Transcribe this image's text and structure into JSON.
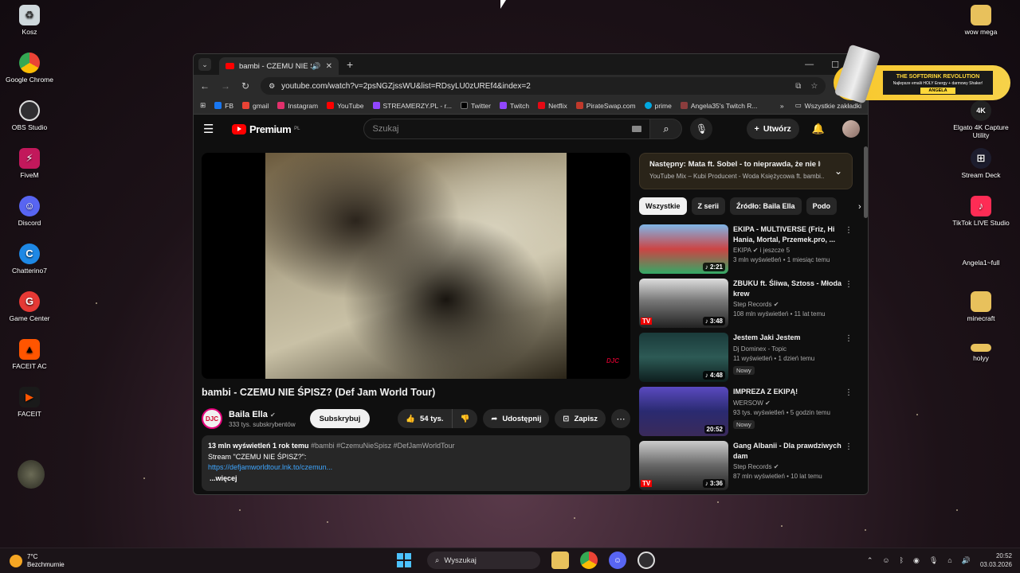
{
  "desktop": {
    "icons_left": [
      {
        "label": "Kosz",
        "icon": "recycle-bin-icon"
      },
      {
        "label": "Google Chrome",
        "icon": "chrome-icon"
      },
      {
        "label": "OBS Studio",
        "icon": "obs-icon"
      },
      {
        "label": "FiveM",
        "icon": "fivem-icon"
      },
      {
        "label": "Discord",
        "icon": "discord-icon"
      },
      {
        "label": "Chatterino7",
        "icon": "chatterino-icon"
      },
      {
        "label": "Game Center",
        "icon": "game-center-icon"
      },
      {
        "label": "FACEIT AC",
        "icon": "faceit-ac-icon"
      },
      {
        "label": "FACEIT",
        "icon": "faceit-icon"
      }
    ],
    "icons_right": [
      {
        "label": "wow mega",
        "icon": "folder-icon"
      },
      {
        "label": "Elgato 4K Capture Utility",
        "icon": "elgato-icon"
      },
      {
        "label": "Stream Deck",
        "icon": "stream-deck-icon"
      },
      {
        "label": "TikTok LIVE Studio",
        "icon": "tiktok-icon"
      },
      {
        "label": "Angela1~full",
        "icon": "file-icon"
      },
      {
        "label": "minecraft",
        "icon": "folder-icon"
      },
      {
        "label": "holyy",
        "icon": "folder-icon"
      }
    ],
    "overlay_ad": {
      "headline": "THE SOFTDRINK REVOLUTION",
      "sub": "Najlepsze emalii HOLY Energy + darmowy Shaker!",
      "name": "ANGELA"
    }
  },
  "browser": {
    "tab_title": "bambi - CZEMU NIE ŚPISZ",
    "url": "youtube.com/watch?v=2psNGZjssWU&list=RDsyLU0zUREf4&index=2",
    "bookmarks": [
      {
        "label": "FB",
        "color": "#1877f2"
      },
      {
        "label": "gmail",
        "color": "#ea4335"
      },
      {
        "label": "Instagram",
        "color": "#e1306c"
      },
      {
        "label": "YouTube",
        "color": "#ff0000"
      },
      {
        "label": "STREAMERZY.PL - r...",
        "color": "#9146ff"
      },
      {
        "label": "Twitter",
        "color": "#000000"
      },
      {
        "label": "Twitch",
        "color": "#9146ff"
      },
      {
        "label": "Netflix",
        "color": "#e50914"
      },
      {
        "label": "PirateSwap.com",
        "color": "#c0392b"
      },
      {
        "label": "prime",
        "color": "#00a8e1"
      },
      {
        "label": "Angela35's Twitch R...",
        "color": "#8b3d3d"
      }
    ],
    "all_bookmarks": "Wszystkie zakładki"
  },
  "youtube": {
    "logo_text": "Premium",
    "logo_region": "PL",
    "search_placeholder": "Szukaj",
    "create_label": "Utwórz",
    "video": {
      "watermark": "DJC",
      "title": "bambi - CZEMU NIE ŚPISZ? (Def Jam World Tour)",
      "channel": "Baila Ella",
      "channel_avatar_text": "DJC",
      "subscribers": "333 tys. subskrybentów",
      "subscribe_label": "Subskrybuj",
      "likes": "54 tys.",
      "share_label": "Udostępnij",
      "save_label": "Zapisz",
      "description": {
        "meta": "13 mln wyświetleń  1 rok temu",
        "tags": "#bambi #CzemuNieSpisz #DefJamWorldTour",
        "line2": "Stream \"CZEMU NIE ŚPISZ?\":",
        "link": "https://defjamworldtour.lnk.to/czemun...",
        "more": "...więcej"
      }
    },
    "next_up": {
      "line1": "Następny: Mata ft. Sobel - to nieprawda, że nie lubi...",
      "line2": "YouTube Mix – Kubi Producent - Woda Księżycowa ft. bambi..."
    },
    "chips": [
      "Wszystkie",
      "Z serii",
      "Źródło: Baila Ella",
      "Podo"
    ],
    "recommendations": [
      {
        "title": "EKIPA - MULTIVERSE (Friz, Hi Hania, Mortal, Przemek.pro, ...",
        "channel": "EKIPA",
        "channel_extra": "i jeszcze 5",
        "meta": "3 mln wyświetleń • 1 miesiąc temu",
        "duration": "2:21",
        "badge": "",
        "verified": true
      },
      {
        "title": "ZBUKU ft. Śliwa, Sztoss - Młoda krew",
        "channel": "Step Records",
        "channel_extra": "",
        "meta": "108 mln wyświetleń • 11 lat temu",
        "duration": "3:48",
        "badge": "",
        "verified": true
      },
      {
        "title": "Jestem Jaki Jestem",
        "channel": "Dj Dominex - Topic",
        "channel_extra": "",
        "meta": "11 wyświetleń • 1 dzień temu",
        "duration": "4:48",
        "badge": "Nowy",
        "verified": false
      },
      {
        "title": "IMPREZA Z EKIPĄ!",
        "channel": "WERSOW",
        "channel_extra": "",
        "meta": "93 tys. wyświetleń • 5 godzin temu",
        "duration": "20:52",
        "badge": "Nowy",
        "verified": true
      },
      {
        "title": "Gang Albanii - Dla prawdziwych dam",
        "channel": "Step Records",
        "channel_extra": "",
        "meta": "87 mln wyświetleń • 10 lat temu",
        "duration": "3:36",
        "badge": "",
        "verified": true
      }
    ]
  },
  "taskbar": {
    "temperature": "7°C",
    "weather": "Bezchmurnie",
    "search_label": "Wyszukaj",
    "time": "20:52",
    "date": "03.03.2026"
  }
}
